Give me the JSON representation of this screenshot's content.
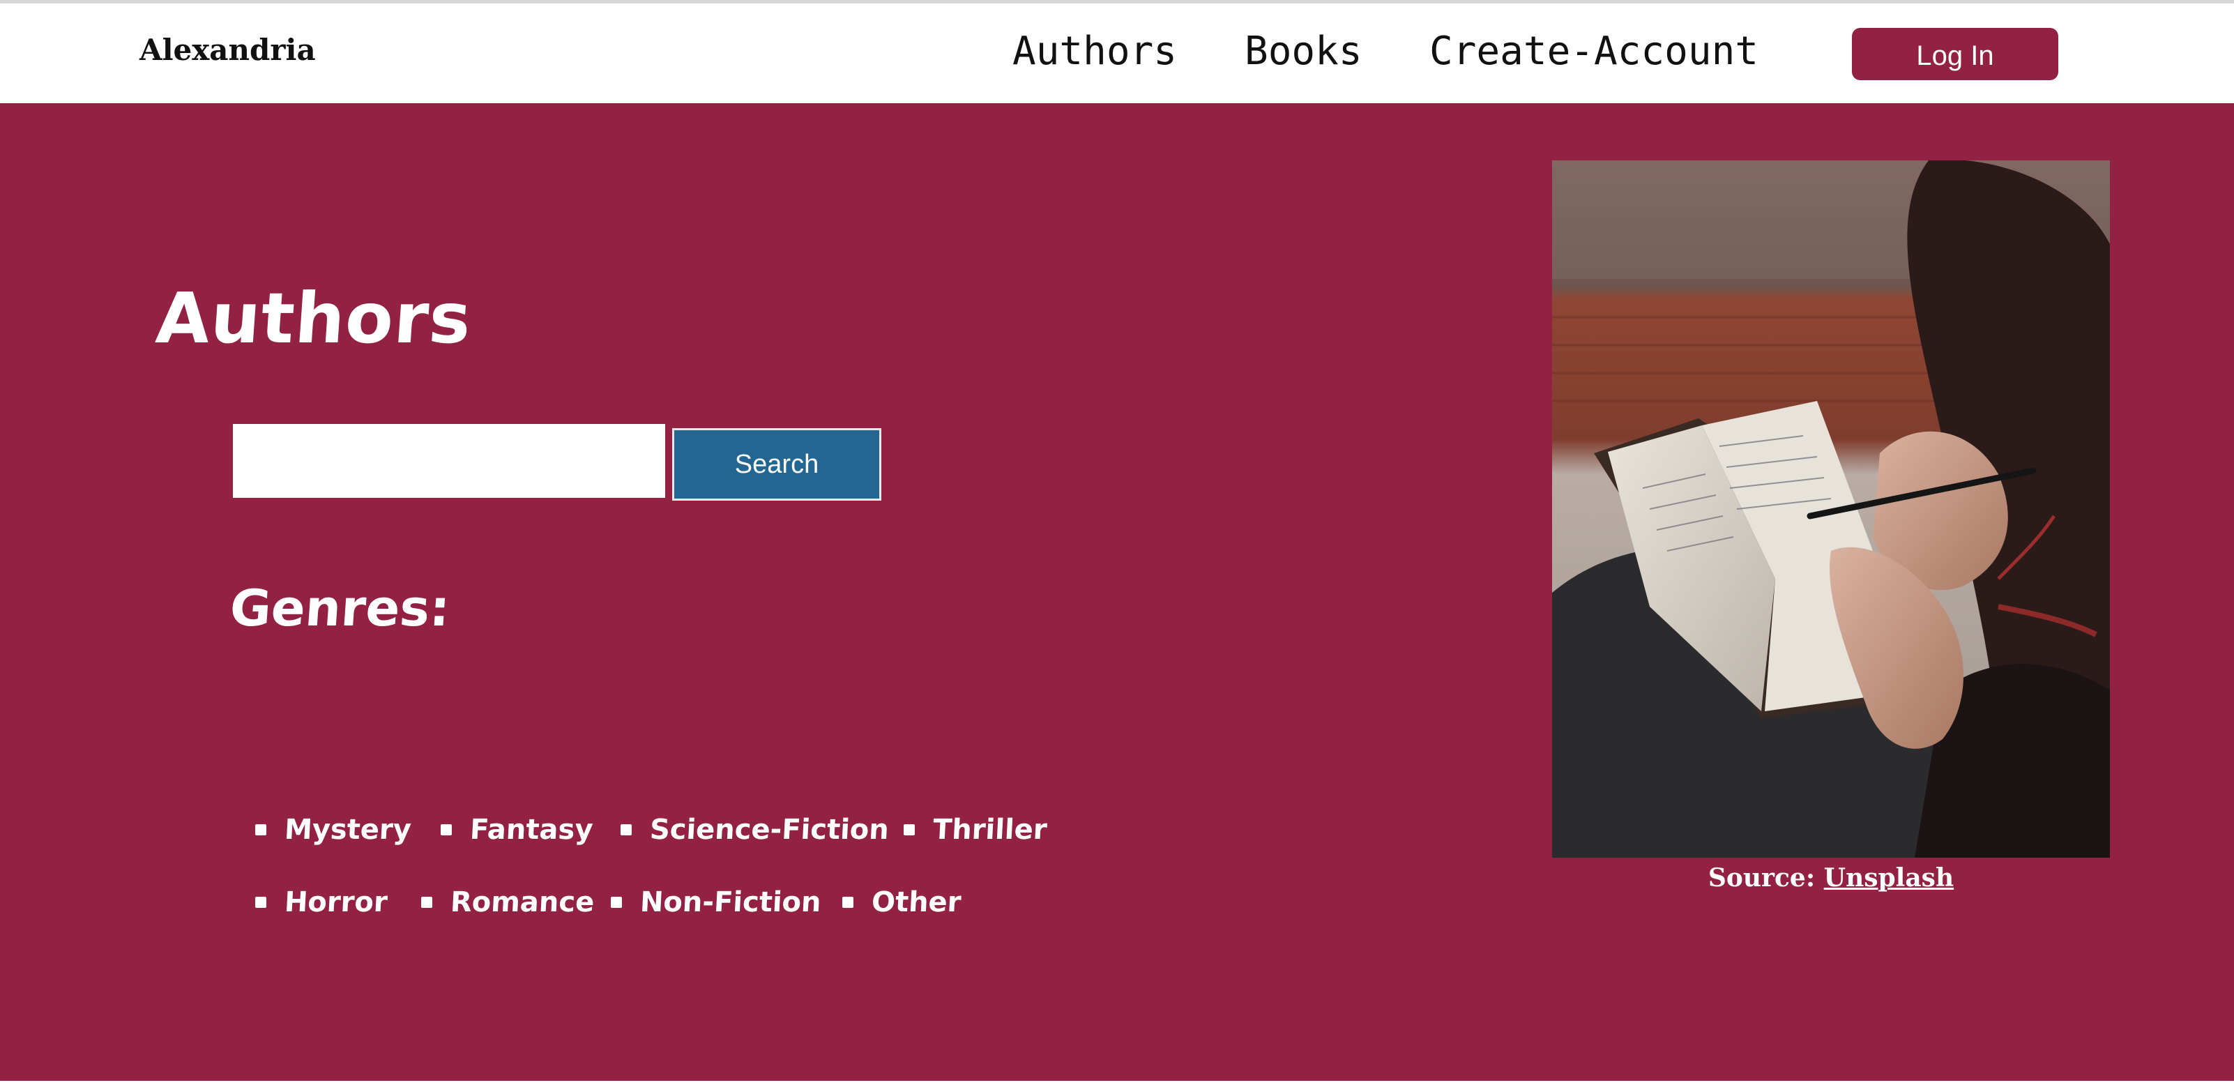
{
  "navbar": {
    "brand": "Alexandria",
    "links": [
      "Authors",
      "Books",
      "Create-Account"
    ],
    "login_label": "Log In"
  },
  "main": {
    "title": "Authors",
    "search": {
      "value": "",
      "placeholder": "",
      "button_label": "Search"
    },
    "genres_title": "Genres:",
    "genres": [
      "Mystery",
      "Fantasy",
      "Science-Fiction",
      "Thriller",
      "Horror",
      "Romance",
      "Non-Fiction",
      "Other"
    ]
  },
  "image": {
    "caption_prefix": "Source:",
    "caption_link": "Unsplash"
  },
  "colors": {
    "accent": "#922143",
    "search_button": "#226691",
    "background": "#ffffff"
  }
}
